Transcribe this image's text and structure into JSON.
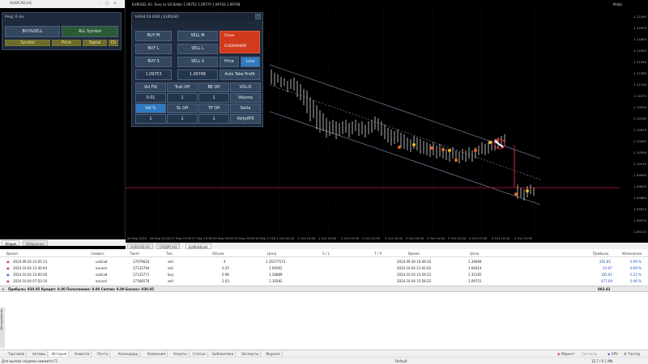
{
  "left_window": {
    "title": "AUDCAD,H1",
    "ping": "Ping: 0 ms",
    "buy_sell": "BUY&SELL",
    "all_symbol": "ALL Symbol",
    "cols": [
      "Symbol",
      "Price",
      "Signal",
      "Ch"
    ]
  },
  "panel": {
    "header": "H2H4 03 EUR | EURUSD",
    "buy_m": "BUY M",
    "sell_m": "SELL M",
    "buy_l": "BUY L",
    "sell_l": "SELL L",
    "buy_s": "BUY S",
    "sell_s": "SELL S",
    "close": "Close",
    "close_value": "0.00000000",
    "price": "Price",
    "loss": "Loss",
    "bid": "1.09753",
    "ask": "1.09748",
    "auto_tp": "Auto Take Profit",
    "vol_fix": "Vol FIX",
    "trail_off": "Trail Off",
    "be_off": "BE Off",
    "vol_d": "VOL-D",
    "v1": "0.01",
    "v2": "1",
    "v3": "1",
    "volume": "Volume",
    "vol_pct": "Vol %",
    "sl_off": "SL Off",
    "tp_off": "TP Off",
    "delta": "Delta",
    "w1": "1",
    "w2": "1",
    "w3": "1",
    "volty": "VoltyATR"
  },
  "chart": {
    "title": "EURUSD, H1:  Euro vs US Dollar  1.09752 1.09770 1.09743 1.09748",
    "label_tr": "Pollut",
    "prices": [
      "1.12160",
      "1.12005",
      "1.11850",
      "1.11695",
      "1.11540",
      "1.11385",
      "1.11230",
      "1.11075",
      "1.10920",
      "1.10765",
      "1.10610",
      "1.10455",
      "1.10300",
      "1.10145",
      "1.09990",
      "1.09835",
      "1.09680",
      "1.09525",
      "1.09370",
      "1.09215"
    ],
    "times": [
      "26 Sep 2024",
      "26 Sep 22:00",
      "27 Sep 07:00",
      "27 Sep 15:00",
      "30 Sep 00:00",
      "30 Sep 09:00",
      "30 Sep 17:00",
      "1 Oct 02:00",
      "1 Oct 10:00",
      "1 Oct 19:00",
      "2 Oct 03:00",
      "2 Oct 12:00",
      "2 Oct 20:00",
      "3 Oct 05:00",
      "3 Oct 14:00",
      "3 Oct 22:00",
      "4 Oct 07:00",
      "4 Oct 15:00",
      "4 Oct 23:00"
    ],
    "tabs": [
      "AUDCAD,H1",
      "CADJPY,H1",
      "EURUSD,H1"
    ],
    "left_tabs": [
      "Общие",
      "Избранное"
    ]
  },
  "history": {
    "headers": [
      "Время",
      "Символ",
      "Тикет",
      "Тип",
      "Объем",
      "Цена",
      "S / L",
      "T / P",
      "Время",
      "Цена",
      "Прибыль",
      "Изменение"
    ],
    "rows": [
      [
        "2024.09.26 23:05:13",
        "usdcad",
        "17079624",
        "sell",
        "4",
        "1.35377573",
        "2024.09.30 16:49:10",
        "1.34968",
        "291.85",
        "0.09 %"
      ],
      [
        "2024.10.02 12:30:44",
        "eurusd",
        "17133794",
        "sell",
        "0.25",
        "1.60562",
        "2024.10.02 21:02:42",
        "1.60414",
        "25.87",
        "0.09 %"
      ],
      [
        "2024.10.02 12:00:56",
        "usdcad",
        "17133771",
        "buy",
        "0.96",
        "1.34889",
        "2024.10.03 15:59:22",
        "1.35165",
        "185.61",
        "0.23 %"
      ],
      [
        "2024.10.04 07:50:10",
        "eurusd",
        "17168578",
        "sell",
        "1.03",
        "1.10282",
        "2024.10.04 15:58:22",
        "1.09751",
        "477.69",
        "0.46 %"
      ]
    ],
    "summary": "Прибыль: 930.05  Кредит: 0.00  Пополнение: 0.00  Снятие: 0.00  Баланс: 930.05",
    "total": "983.42"
  },
  "bottom_tabs": [
    "Торговля",
    "Активы",
    "История",
    "Новости",
    "Почта",
    "Календарь",
    "Компания",
    "Алерты",
    "Статьи",
    "Библиотека",
    "Эксперты",
    "Журнал"
  ],
  "bottom_right": {
    "market": "Маркет",
    "signals": "Сигналы",
    "vps": "VPS",
    "tester": "Тестер"
  },
  "status": {
    "help": "Для вызова справки нажмите F1",
    "profile": "Default",
    "net": "12.7 / 0.1 Mb"
  },
  "side_tab": "Инструменты"
}
